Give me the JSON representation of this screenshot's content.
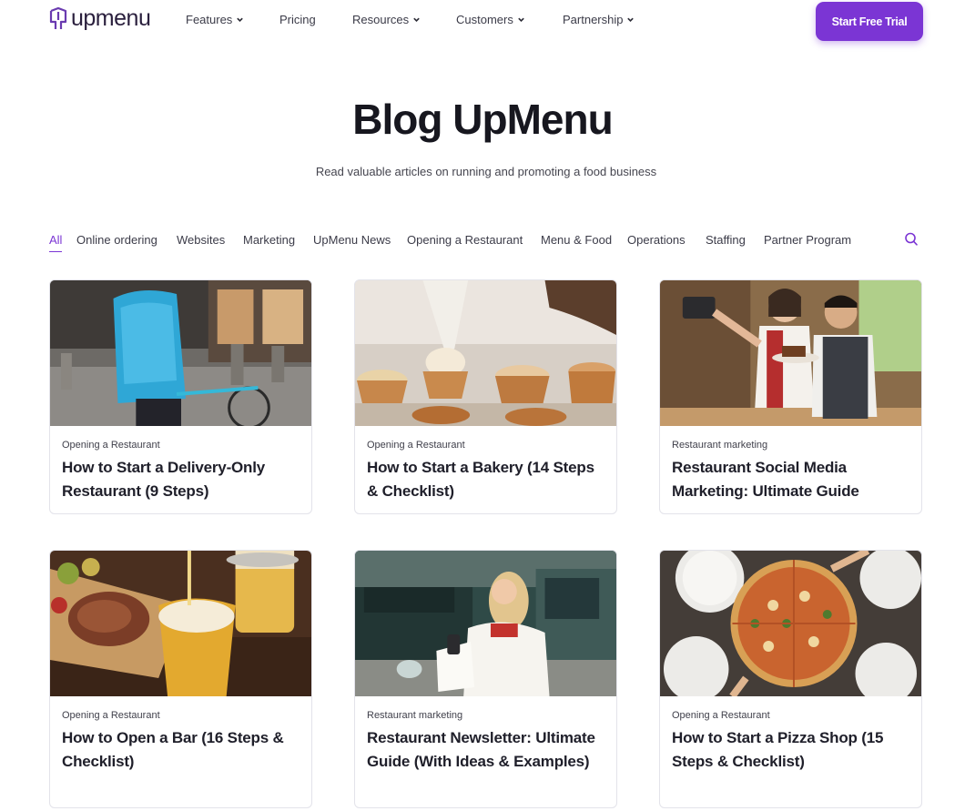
{
  "header": {
    "logo_text": "upmenu",
    "nav": [
      {
        "label": "Features",
        "has_dropdown": true
      },
      {
        "label": "Pricing",
        "has_dropdown": false
      },
      {
        "label": "Resources",
        "has_dropdown": true
      },
      {
        "label": "Customers",
        "has_dropdown": true
      },
      {
        "label": "Partnership",
        "has_dropdown": true
      }
    ],
    "cta_label": "Start Free Trial"
  },
  "hero": {
    "title": "Blog UpMenu",
    "subtitle": "Read valuable articles on running and promoting a food business"
  },
  "filters": {
    "items": [
      "All",
      "Online ordering",
      "Websites",
      "Marketing",
      "UpMenu News",
      "Opening a Restaurant",
      "Menu & Food",
      "Operations",
      "Staffing",
      "Partner Program"
    ],
    "active": "All"
  },
  "posts": [
    {
      "category": "Opening a Restaurant",
      "title": "How to Start a Delivery-Only Restaurant (9 Steps)",
      "image": "delivery-courier-photo"
    },
    {
      "category": "Opening a Restaurant",
      "title": "How to Start a Bakery (14 Steps & Checklist)",
      "image": "cupcakes-piping-photo"
    },
    {
      "category": "Restaurant marketing",
      "title": "Restaurant Social Media Marketing: Ultimate Guide",
      "image": "couple-selfie-photo"
    },
    {
      "category": "Opening a Restaurant",
      "title": "How to Open a Bar (16 Steps & Checklist)",
      "image": "beer-steak-photo"
    },
    {
      "category": "Restaurant marketing",
      "title": "Restaurant Newsletter: Ultimate Guide (With Ideas & Examples)",
      "image": "woman-takeout-phone-photo"
    },
    {
      "category": "Opening a Restaurant",
      "title": "How to Start a Pizza Shop (15 Steps & Checklist)",
      "image": "pizza-table-photo"
    }
  ],
  "colors": {
    "accent": "#7b35d4",
    "text": "#1d1d27",
    "border": "#e3e3ea"
  }
}
